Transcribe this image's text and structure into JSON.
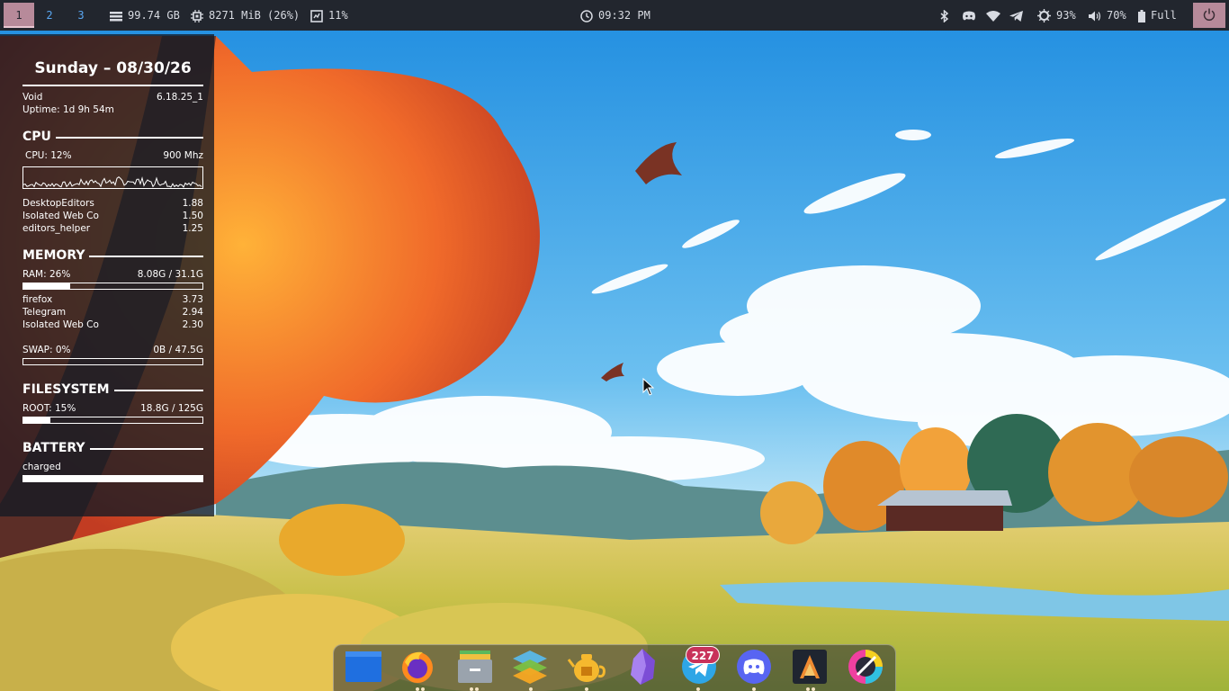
{
  "topbar": {
    "workspaces": [
      "1",
      "2",
      "3"
    ],
    "active_workspace": "1",
    "disk": "99.74 GB",
    "memory": "8271 MiB (26%)",
    "cpu": "11%",
    "clock": "09:32 PM",
    "brightness": "93%",
    "volume": "70%",
    "battery": "Full",
    "tray_icons": [
      "bluetooth-icon",
      "discord-icon",
      "wifi-icon",
      "telegram-icon"
    ]
  },
  "conky": {
    "date": "Sunday – 08/30/26",
    "os": "Void",
    "kernel": "6.18.25_1",
    "uptime": "Uptime: 1d 9h 54m",
    "cpu": {
      "title": "CPU",
      "usage_label": "CPU: 12%",
      "freq": "900 Mhz",
      "usage": 0.12,
      "processes": [
        {
          "name": "DesktopEditors",
          "value": "1.88"
        },
        {
          "name": "Isolated Web Co",
          "value": "1.50"
        },
        {
          "name": "editors_helper",
          "value": "1.25"
        }
      ]
    },
    "memory": {
      "title": "MEMORY",
      "ram_label": "RAM: 26%",
      "ram_value": "8.08G / 31.1G",
      "ram_fraction": 0.26,
      "processes": [
        {
          "name": "firefox",
          "value": "3.73"
        },
        {
          "name": "Telegram",
          "value": "2.94"
        },
        {
          "name": "Isolated Web Co",
          "value": "2.30"
        }
      ],
      "swap_label": "SWAP: 0%",
      "swap_value": "0B / 47.5G",
      "swap_fraction": 0.0
    },
    "filesystem": {
      "title": "FILESYSTEM",
      "root_label": "ROOT:  15%",
      "root_value": "18.8G / 125G",
      "root_fraction": 0.15
    },
    "battery": {
      "title": "BATTERY",
      "status": "charged",
      "fraction": 1.0
    }
  },
  "dock": {
    "apps": [
      "files-icon",
      "firefox-icon",
      "file-manager-icon",
      "stacks-icon",
      "teapot-icon",
      "obsidian-icon",
      "telegram-icon",
      "discord-icon",
      "alacritty-icon",
      "krita-icon"
    ],
    "telegram_badge": "227"
  },
  "colors": {
    "bar_bg": "#22262e",
    "accent": "#b78a9a",
    "workspace_fg": "#5aa7f2",
    "panel_bg": "rgba(20,26,36,0.78)"
  }
}
